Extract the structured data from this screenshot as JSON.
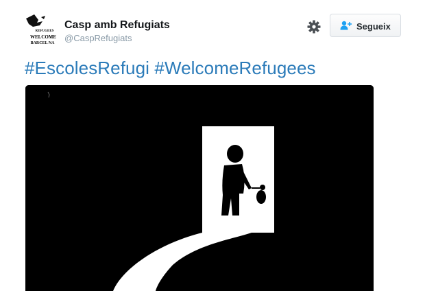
{
  "tweet": {
    "author": {
      "display_name": "Casp amb Refugiats",
      "screen_name": "@CaspRefugiats",
      "avatar": {
        "line1": "REFUGEES",
        "line2": "WELCOME",
        "line3": "BARCEL NA"
      }
    },
    "actions": {
      "settings_icon": "gear-icon",
      "follow_icon": "add-user-icon",
      "follow_label": "Segueix"
    },
    "hashtags": [
      "#EscolesRefugi",
      "#WelcomeRefugees"
    ],
    "media": {
      "description_icon": "refugee-doorway-illustration"
    }
  },
  "colors": {
    "link": "#2b7bb9",
    "name": "#14171a",
    "handle": "#8899a6",
    "media_bg": "#000000",
    "icon_blue": "#1da1f2"
  }
}
